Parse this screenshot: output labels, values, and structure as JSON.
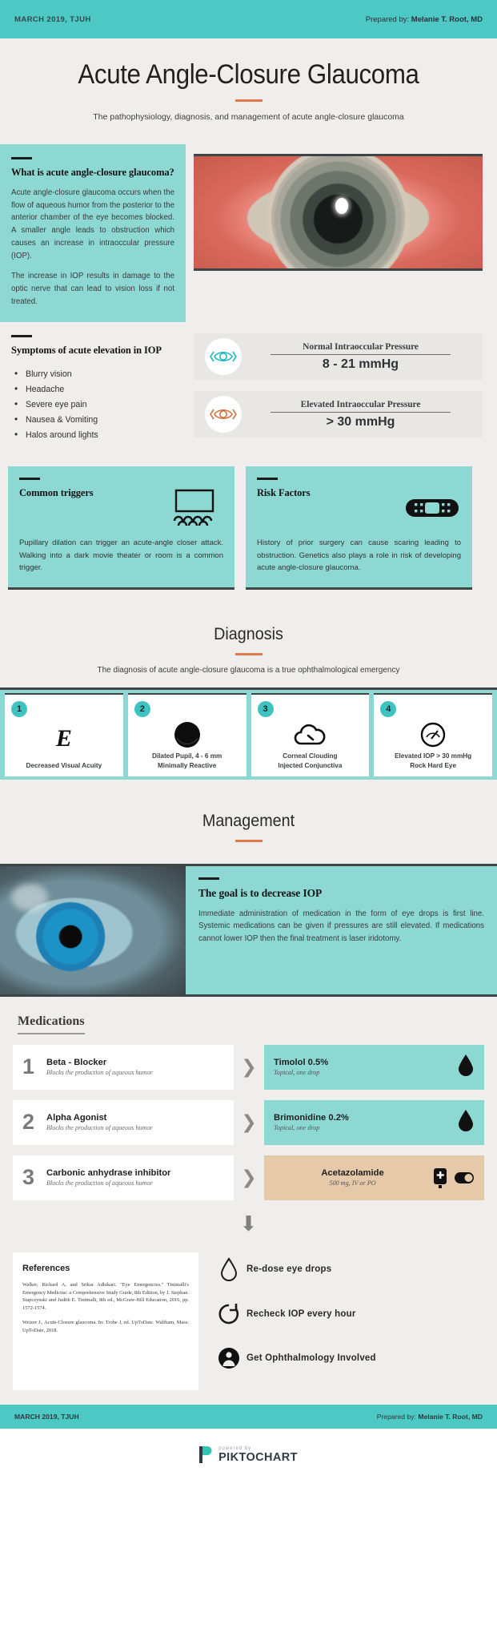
{
  "topbar": {
    "left": "MARCH 2019,  TJUH",
    "prepared_prefix": "Prepared by:",
    "author": "Melanie T. Root, MD"
  },
  "hero": {
    "title": "Acute Angle-Closure Glaucoma",
    "subtitle": "The pathophysiology, diagnosis, and management of acute angle-closure glaucoma"
  },
  "what_is": {
    "heading": "What is acute angle-closure glaucoma?",
    "p1": "Acute angle-closure glaucoma occurs when the flow of aqueous humor from the posterior to the anterior chamber of the eye becomes blocked. A smaller angle leads to obstruction which causes an increase in intraoccular pressure (IOP).",
    "p2": "The increase in IOP results in damage to the optic nerve that can lead to vision loss if not treated."
  },
  "symptoms": {
    "heading": "Symptoms of acute elevation in IOP",
    "items": [
      "Blurry vision",
      "Headache",
      "Severe eye pain",
      "Nausea & Vomiting",
      "Halos around lights"
    ]
  },
  "pressures": [
    {
      "label": "Normal Intraoccular Pressure",
      "value": "8 - 21 mmHg",
      "icon": "eye-icon",
      "color": "#21b6bd"
    },
    {
      "label": "Elevated Intraoccular Pressure",
      "value": "> 30 mmHg",
      "icon": "eye-icon",
      "color": "#d2703c"
    }
  ],
  "cards": [
    {
      "heading": "Common triggers",
      "icon": "movie-theater-icon",
      "body": "Pupillary dilation can trigger an acute-angle closer   attack. Walking into a dark movie theater or room is a common trigger."
    },
    {
      "heading": "Risk Factors",
      "icon": "bandage-icon",
      "body": "History of prior surgery can cause scaring leading to obstruction. Genetics also plays a role in risk of developing acute angle-closure glaucoma."
    }
  ],
  "diagnosis": {
    "title": "Diagnosis",
    "subtitle": "The diagnosis of acute angle-closure glaucoma is a true ophthalmological emergency",
    "cards": [
      {
        "num": "1",
        "icon": "snellen-e-icon",
        "caption": "Decreased Visual Acuity"
      },
      {
        "num": "2",
        "icon": "dilated-pupil-icon",
        "caption": "Dilated Pupil, 4 - 6 mm\nMinimally Reactive"
      },
      {
        "num": "3",
        "icon": "cloud-icon",
        "caption": "Corneal Clouding\nInjected Conjunctiva"
      },
      {
        "num": "4",
        "icon": "pressure-gauge-icon",
        "caption": "Elevated IOP > 30 mmHg\nRock Hard Eye"
      }
    ]
  },
  "management": {
    "title": "Management",
    "goal_heading": "The goal is to decrease IOP",
    "goal_body": "Immediate administration of medication in the form of eye drops is first line. Systemic medications can be given if pressures are still elevated. If medications cannot lower IOP then the final treatment is laser iridotomy."
  },
  "medications": {
    "title": "Medications",
    "rows": [
      {
        "rank": "1",
        "class_name": "Beta - Blocker",
        "class_sub": "Blocks the production of aqueous humor",
        "drug": "Timolol 0.5%",
        "dose": "Topical, one drop",
        "right_bg": "#8ed8d4",
        "icon": "eye-drop-icon"
      },
      {
        "rank": "2",
        "class_name": "Alpha Agonist",
        "class_sub": "Blocks the production of aqueous humor",
        "drug": "Brimonidine 0.2%",
        "dose": "Topical, one drop",
        "right_bg": "#8ed8d4",
        "icon": "eye-drop-icon"
      },
      {
        "rank": "3",
        "class_name": "Carbonic anhydrase inhibitor",
        "class_sub": "Blocks the production of aqueous humor",
        "drug": "Acetazolamide",
        "dose": "500 mg, IV or PO",
        "right_bg": "#e5c9a9",
        "icon": "iv-bag-icon"
      }
    ]
  },
  "references": {
    "title": "References",
    "items": [
      "Walker, Richard A, and Srikar Adhikari. \"Eye Emergencies.\" Tintinalli's Emergency Medicine: a Comprehensive Study Guide, 8th Edition, by J. Stephan. Stapczynski and Judith E. Tintinalli, 8th ed., McGraw-Hill Education, 2016, pp. 1572-1574.",
      "Weizer J., Acute-Closure glaucoma. In: Trobe J, ed. UpToDate. Waltham, Mass: UpToDate, 2018."
    ]
  },
  "steps": [
    {
      "icon": "eye-drop-icon",
      "label": "Re-dose eye drops"
    },
    {
      "icon": "refresh-icon",
      "label": "Recheck IOP every  hour"
    },
    {
      "icon": "doctor-icon",
      "label": "Get Ophthalmology Involved"
    }
  ],
  "footer": {
    "left": "MARCH 2019,  TJUH",
    "prepared_prefix": "Prepared by:",
    "author": "Melanie T. Root, MD"
  },
  "pikto": {
    "powered": "powered by",
    "brand": "PIKTOCHART"
  },
  "colors": {
    "teal": "#8ed8d4",
    "teal_bar": "#4ec8c4",
    "orange": "#e07a46",
    "bg": "#efeeec",
    "dark": "#3e4547"
  }
}
